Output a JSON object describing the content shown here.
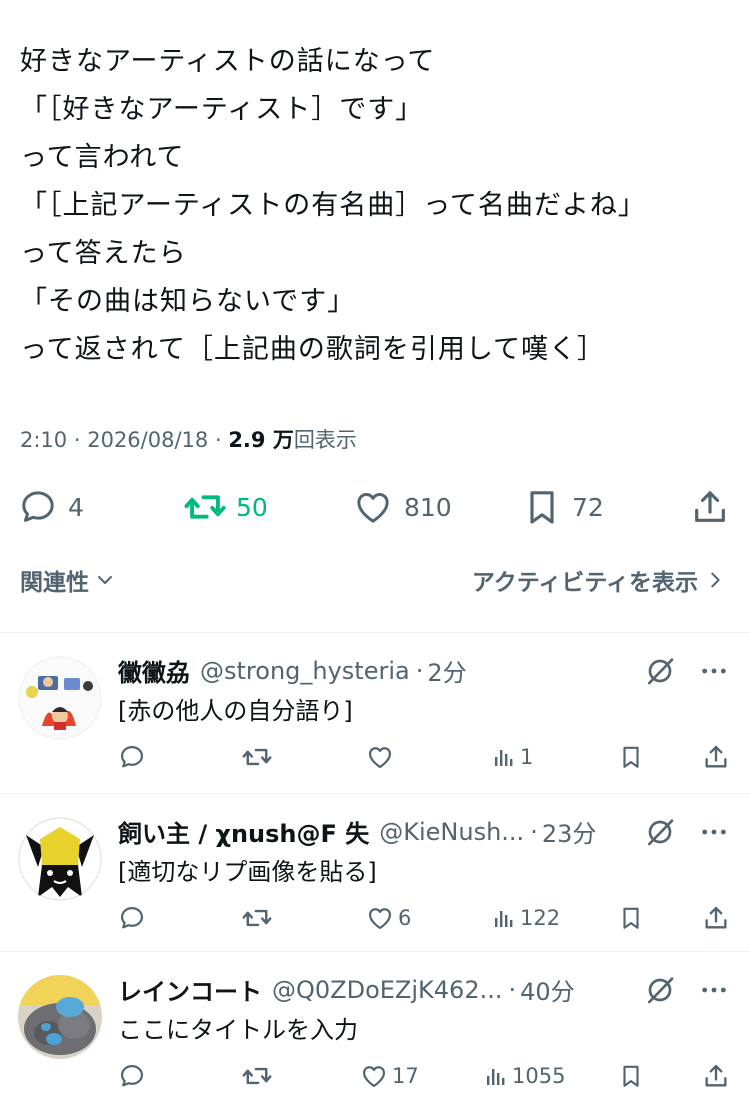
{
  "tweet": {
    "lines": [
      "好きなアーティストの話になって",
      "「［好きなアーティスト］です」",
      "って言われて",
      "「［上記アーティストの有名曲］って名曲だよね」",
      "って答えたら",
      "「その曲は知らないです」",
      "って返されて［上記曲の歌詞を引用して嘆く］"
    ],
    "time": "2:10",
    "date": "2026/08/18",
    "views_count": "2.9 万",
    "views_label": "回表示"
  },
  "actions": {
    "replies": "4",
    "retweets": "50",
    "likes": "810",
    "bookmarks": "72",
    "retweet_color": "#00ba7c"
  },
  "sort": {
    "label": "関連性"
  },
  "activity": {
    "label": "アクティビティを表示"
  },
  "replies": [
    {
      "name": "黴黴劦",
      "handle": "@strong_hysteria",
      "time": "2分",
      "text": "[赤の他人の自分語り]",
      "likes": "",
      "views": "1"
    },
    {
      "name": "飼い主 / χnush@F 失",
      "handle": "@KieNush...",
      "time": "23分",
      "text": "[適切なリプ画像を貼る]",
      "likes": "6",
      "views": "122"
    },
    {
      "name": "レインコート",
      "handle": "@Q0ZDoEZjK462...",
      "time": "40分",
      "text": "ここにタイトルを入力",
      "likes": "17",
      "views": "1055"
    }
  ]
}
